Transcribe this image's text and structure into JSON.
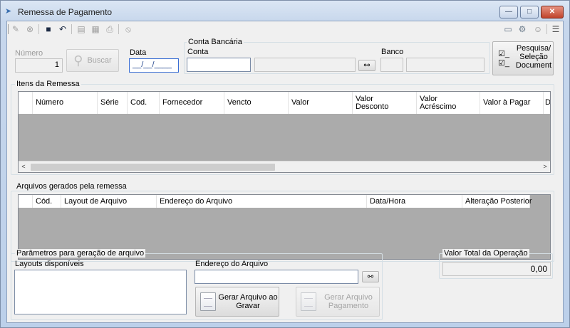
{
  "window": {
    "title": "Remessa de Pagamento",
    "buttons": {
      "minimize": "—",
      "maximize": "□",
      "close": "✕"
    }
  },
  "header": {
    "numero_label": "Número",
    "numero_value": "1",
    "buscar_label": "Buscar",
    "data_label": "Data",
    "data_value": "__/__/____",
    "conta_bancaria_title": "Conta Bancária",
    "conta_label": "Conta",
    "banco_label": "Banco",
    "pesquisa_line1": "Pesquisa/",
    "pesquisa_line2": "Seleção",
    "pesquisa_line3": "Document"
  },
  "itens": {
    "title": "Itens da Remessa",
    "columns": [
      {
        "line1": "Número",
        "line2": ""
      },
      {
        "line1": "Série",
        "line2": ""
      },
      {
        "line1": "Cod.",
        "line2": ""
      },
      {
        "line1": "Fornecedor",
        "line2": ""
      },
      {
        "line1": "Vencto",
        "line2": ""
      },
      {
        "line1": "Valor",
        "line2": ""
      },
      {
        "line1": "Valor",
        "line2": "Desconto"
      },
      {
        "line1": "Valor",
        "line2": "Acréscimo"
      },
      {
        "line1": "Valor à Pagar",
        "line2": ""
      },
      {
        "line1": "D",
        "line2": ""
      }
    ]
  },
  "arquivos": {
    "title": "Arquivos gerados pela remessa",
    "columns": [
      "Cód.",
      "Layout de Arquivo",
      "Endereço do Arquivo",
      "Data/Hora",
      "Alteração Posterior"
    ]
  },
  "parametros": {
    "title": "Parâmetros para geração de arquivo",
    "layouts_label": "Layouts disponíveis",
    "endereco_label": "Endereço do Arquivo",
    "gerar_gravar_line1": "Gerar Arquivo ao",
    "gerar_gravar_line2": "Gravar",
    "gerar_pagamento_line1": "Gerar Arquivo",
    "gerar_pagamento_line2": "Pagamento"
  },
  "total": {
    "title": "Valor Total da Operação",
    "value": "0,00"
  }
}
